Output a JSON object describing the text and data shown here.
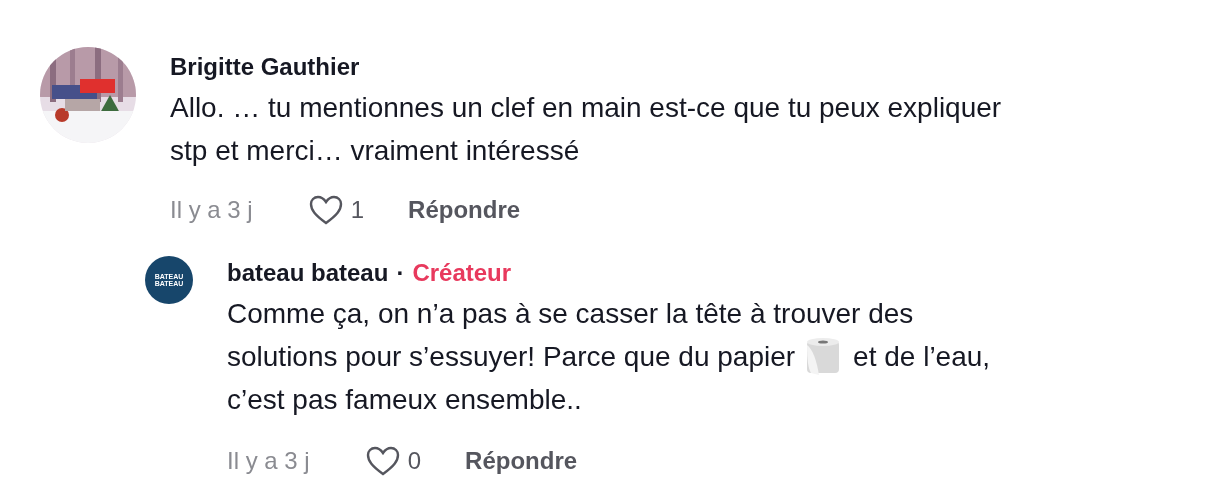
{
  "comments": [
    {
      "author": "Brigitte Gauthier",
      "avatar": {
        "kind": "picture"
      },
      "text_lines": [
        [
          {
            "kind": "text",
            "text": "Allo. … tu mentionnes un clef en main est-ce que tu peux expliquer"
          }
        ],
        [
          {
            "kind": "text",
            "text": "stp et merci… vraiment intéressé"
          }
        ]
      ],
      "time": "Il y a 3 j",
      "liked": false,
      "likes": "1",
      "reply_label": "Répondre",
      "replies": [
        {
          "author": "bateau bateau",
          "separator": "·",
          "badge": "Créateur",
          "avatar": {
            "kind": "logo",
            "lines": [
              "BATEAU",
              "BATEAU"
            ]
          },
          "text_lines": [
            [
              {
                "kind": "text",
                "text": "Comme ça, on n’a pas à se casser la tête à trouver des"
              }
            ],
            [
              {
                "kind": "text",
                "text": "solutions pour s’essuyer! Parce que du papier"
              },
              {
                "kind": "emoji"
              },
              {
                "kind": "text",
                "text": "et de l’eau,"
              }
            ],
            [
              {
                "kind": "text",
                "text": "c’est pas fameux ensemble.."
              }
            ]
          ],
          "time": "Il y a 3 j",
          "liked": false,
          "likes": "0",
          "reply_label": "Répondre"
        }
      ]
    }
  ]
}
